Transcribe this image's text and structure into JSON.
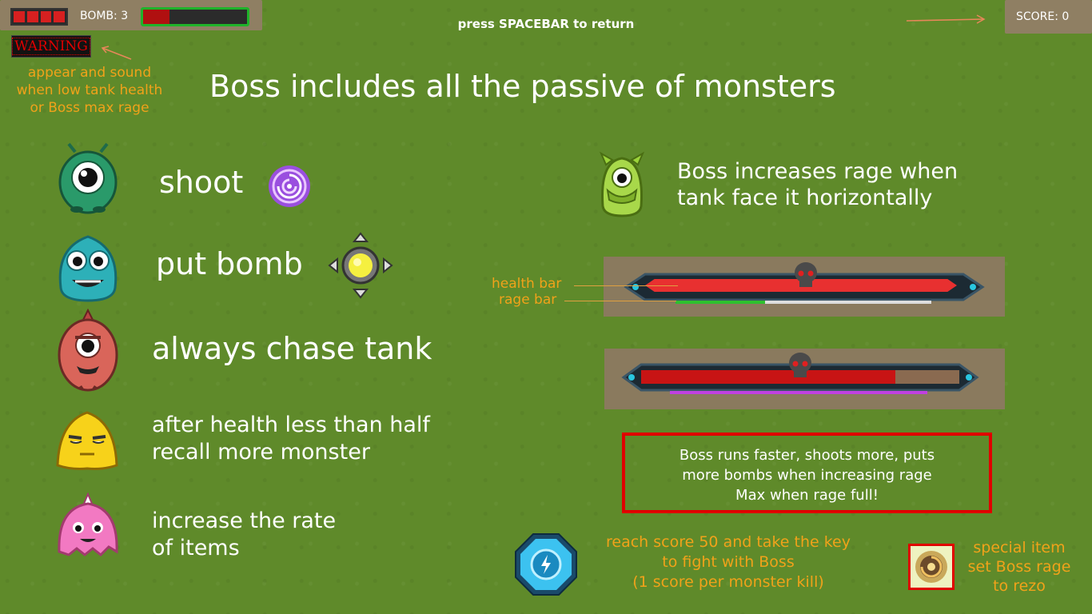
{
  "hud": {
    "bomb_label": "BOMB: 3",
    "score_label": "SCORE: 0",
    "tank_health_pct": 0.25,
    "hp_blocks_filled": 4,
    "warning_text": "WARNING"
  },
  "hint": {
    "return_text": "press SPACEBAR to return"
  },
  "warning_note": {
    "line1": "appear and sound",
    "line2": "when low tank health",
    "line3": "or Boss max rage"
  },
  "title": "Boss includes all the passive of monsters",
  "monsters": [
    {
      "name": "green-eye-monster-icon",
      "text1": "shoot",
      "text2": ""
    },
    {
      "name": "teal-monster-icon",
      "text1": "put bomb",
      "text2": ""
    },
    {
      "name": "red-horn-monster-icon",
      "text1": "always chase tank",
      "text2": ""
    },
    {
      "name": "yellow-blob-monster-icon",
      "text1": "after health less than half",
      "text2": "recall more monster"
    },
    {
      "name": "pink-monster-icon",
      "text1": "increase the rate",
      "text2": "of items"
    }
  ],
  "rage_info": {
    "line1": "Boss increases rage when",
    "line2": "tank face it horizontally"
  },
  "boss_bars": {
    "health_label": "health bar",
    "rage_label": "rage bar",
    "bar1_health": 1.0,
    "bar1_rage": 0.35,
    "bar2_health": 0.8,
    "bar2_rage": 1.0
  },
  "rage_box": {
    "line1": "Boss runs faster, shoots more, puts",
    "line2": "more bombs when increasing rage",
    "line3": "Max when rage full!"
  },
  "key_info": {
    "line1": "reach score 50 and take the key",
    "line2": "to fight with Boss",
    "line3": "(1 score per monster kill)"
  },
  "special_item": {
    "line1": "special item",
    "line2": "set Boss rage",
    "line3": "to rezo"
  },
  "colors": {
    "accent_orange": "#f0a21a",
    "warning_red": "#e00000",
    "health_red": "#e83030",
    "rage_green": "#2ec02e",
    "rage_purple": "#c040e0"
  }
}
